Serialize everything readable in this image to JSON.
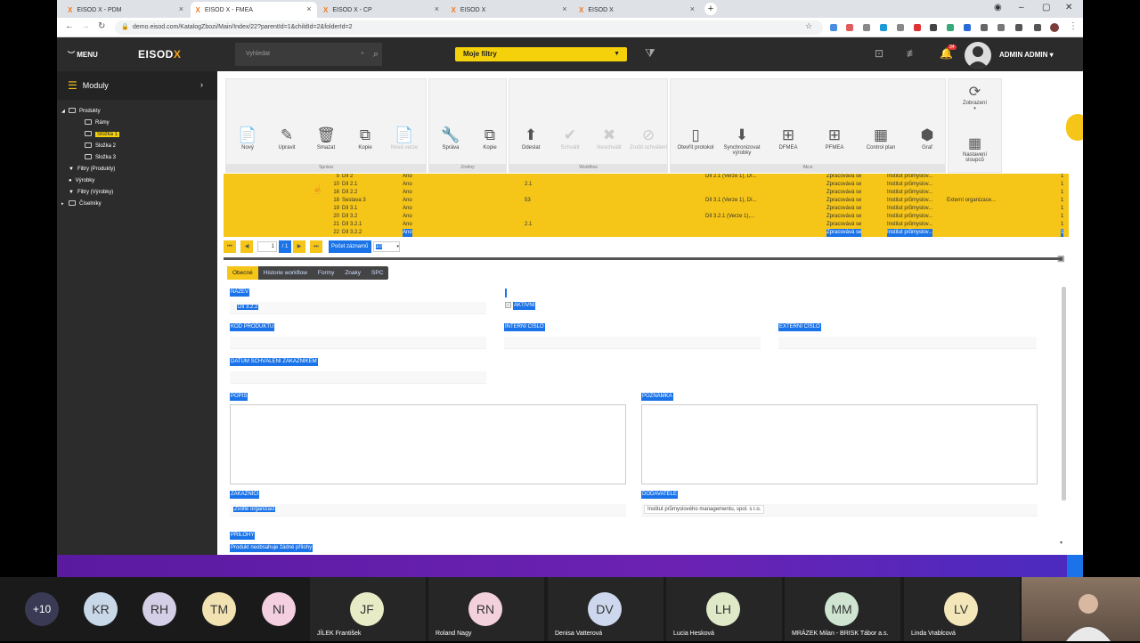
{
  "browser": {
    "tabs": [
      {
        "title": "EISOD X - PDM",
        "active": false
      },
      {
        "title": "EISOD X - FMEA",
        "active": true
      },
      {
        "title": "EISOD X - CP",
        "active": false
      },
      {
        "title": "EISOD X",
        "active": false
      },
      {
        "title": "EISOD X",
        "active": false
      }
    ],
    "url": "demo.eisod.com/KatalogZbozi/Main/Index/22?parentId=1&childId=2&folderId=2"
  },
  "header": {
    "menu_label": "MENU",
    "logo": "EISOD",
    "logo_accent": "X",
    "search_placeholder": "Vyhledat",
    "filters_label": "Moje filtry",
    "notifications_count": "34",
    "user_name": "ADMIN ADMIN"
  },
  "sidebar": {
    "title": "Moduly",
    "tree": [
      {
        "label": "Produkty",
        "level": 0,
        "arrow": "◢"
      },
      {
        "label": "Rámy",
        "level": 1
      },
      {
        "label": "Složka 1",
        "level": 1,
        "selected": true
      },
      {
        "label": "Složka 2",
        "level": 1
      },
      {
        "label": "Složka 3",
        "level": 1
      },
      {
        "label": "Filtry (Produkty)",
        "level": 0,
        "marker": "filter"
      },
      {
        "label": "Výrobky",
        "level": 0,
        "marker": "dot"
      },
      {
        "label": "Filtry (Výrobky)",
        "level": 0,
        "marker": "filter"
      },
      {
        "label": "Číselníky",
        "level": 0,
        "arrow": "▸"
      }
    ]
  },
  "toolbar": {
    "groups": [
      {
        "label": "Správa",
        "buttons": [
          {
            "label": "Nový"
          },
          {
            "label": "Upravit"
          },
          {
            "label": "Smazat"
          },
          {
            "label": "Kopie"
          },
          {
            "label": "Nová verze",
            "disabled": true
          }
        ]
      },
      {
        "label": "Změny",
        "buttons": [
          {
            "label": "Správa"
          },
          {
            "label": "Kopie"
          }
        ]
      },
      {
        "label": "Workflow",
        "buttons": [
          {
            "label": "Odeslat"
          },
          {
            "label": "Schválit",
            "disabled": true
          },
          {
            "label": "Neschválit",
            "disabled": true
          },
          {
            "label": "Zrušit schválení",
            "disabled": true
          }
        ]
      },
      {
        "label": "Akce",
        "buttons": [
          {
            "label": "Otevřít protokol"
          },
          {
            "label": "Synchronizovat výrobky"
          },
          {
            "label": "DFMEA"
          },
          {
            "label": "PFMEA"
          },
          {
            "label": "Control plan"
          },
          {
            "label": "Graf"
          }
        ]
      }
    ],
    "view_label": "Zobrazení",
    "columns_label": "Nastavení sloupců"
  },
  "grid": {
    "rows": [
      {
        "num": "5",
        "name": "Díl 2",
        "active": "Ano",
        "ver": "",
        "parent": "Díl 2.1 (Verze 1), Dí...",
        "state": "Zpracovává se",
        "org": "Institut průmyslov...",
        "ext": "",
        "count": "1"
      },
      {
        "num": "10",
        "name": "Díl 2.1",
        "active": "Ano",
        "ver": "2.1",
        "parent": "",
        "state": "Zpracovává se",
        "org": "Institut průmyslov...",
        "ext": "",
        "count": "1"
      },
      {
        "num": "16",
        "name": "Díl 2.2",
        "active": "Ano",
        "ver": "",
        "parent": "",
        "state": "Zpracovává se",
        "org": "Institut průmyslov...",
        "ext": "",
        "count": "1"
      },
      {
        "num": "18",
        "name": "Sestava 3",
        "active": "Ano",
        "ver": "53",
        "parent": "Díl 3.1 (Verze 1), Dí...",
        "state": "Zpracovává se",
        "org": "Institut průmyslov...",
        "ext": "Externí organizace...",
        "count": "1"
      },
      {
        "num": "19",
        "name": "Díl 3.1",
        "active": "Ano",
        "ver": "",
        "parent": "",
        "state": "Zpracovává se",
        "org": "Institut průmyslov...",
        "ext": "",
        "count": "1"
      },
      {
        "num": "20",
        "name": "Díl 3.2",
        "active": "Ano",
        "ver": "",
        "parent": "Díl 3.2.1 (Verze 1),...",
        "state": "Zpracovává se",
        "org": "Institut průmyslov...",
        "ext": "",
        "count": "1"
      },
      {
        "num": "21",
        "name": "Díl 3.2.1",
        "active": "Ano",
        "ver": "2.1",
        "parent": "",
        "state": "Zpracovává se",
        "org": "Institut průmyslov...",
        "ext": "",
        "count": "1"
      },
      {
        "num": "22",
        "name": "Díl 3.2.2",
        "active": "Ano",
        "ver": "",
        "parent": "",
        "state": "Zpracovává se",
        "org": "Institut průmyslov...",
        "ext": "",
        "count": "1",
        "selected": true
      }
    ]
  },
  "pager": {
    "page": "1",
    "total": "/ 1",
    "count_label": "Počet záznamů",
    "page_size": "10"
  },
  "detail": {
    "tabs": [
      "Obecné",
      "Historie workflow",
      "Formy",
      "Znaky",
      "SPC"
    ],
    "labels": {
      "name": "NÁZEV",
      "active": "AKTIVNÍ",
      "code": "KÓD PRODUKTU",
      "internal": "INTERNÍ ČÍSLO",
      "external": "EXTERNÍ ČÍSLO",
      "approval_date": "DATUM SCHVÁLENÍ ZÁKAZNÍKEM",
      "description": "POPIS",
      "note": "POZNÁMKA",
      "customers": "ZÁKAZNÍCI",
      "suppliers": "DODAVATELÉ",
      "attachments": "PŘÍLOHY"
    },
    "values": {
      "name": "Díl 3.2.2",
      "customers": "Zvolte organizaci",
      "suppliers": "Institut průmyslového managementu, spol. s r.o.",
      "attachments": "Produkt neobsahuje žádné přílohy"
    }
  },
  "participants": {
    "more": "+10",
    "people": [
      {
        "initials": "KR",
        "name": "",
        "color": "#c9d8e8"
      },
      {
        "initials": "RH",
        "name": "",
        "color": "#d4cfe6"
      },
      {
        "initials": "TM",
        "name": "",
        "color": "#f2e2b2"
      },
      {
        "initials": "NI",
        "name": "",
        "color": "#f3cfe0"
      },
      {
        "initials": "JF",
        "name": "JÍLEK František",
        "color": "#e8ecc6"
      },
      {
        "initials": "RN",
        "name": "Roland Nagy",
        "color": "#f3d1dc"
      },
      {
        "initials": "DV",
        "name": "Denisa Vatterová",
        "color": "#cdd8ee"
      },
      {
        "initials": "LH",
        "name": "Lucia Hesková",
        "color": "#dfe9c8"
      },
      {
        "initials": "MM",
        "name": "MRÁZEK Milan - BRISK Tábor a.s.",
        "color": "#cfe5d2"
      },
      {
        "initials": "LV",
        "name": "Linda Vrablcová",
        "color": "#f3e6b8"
      }
    ]
  }
}
